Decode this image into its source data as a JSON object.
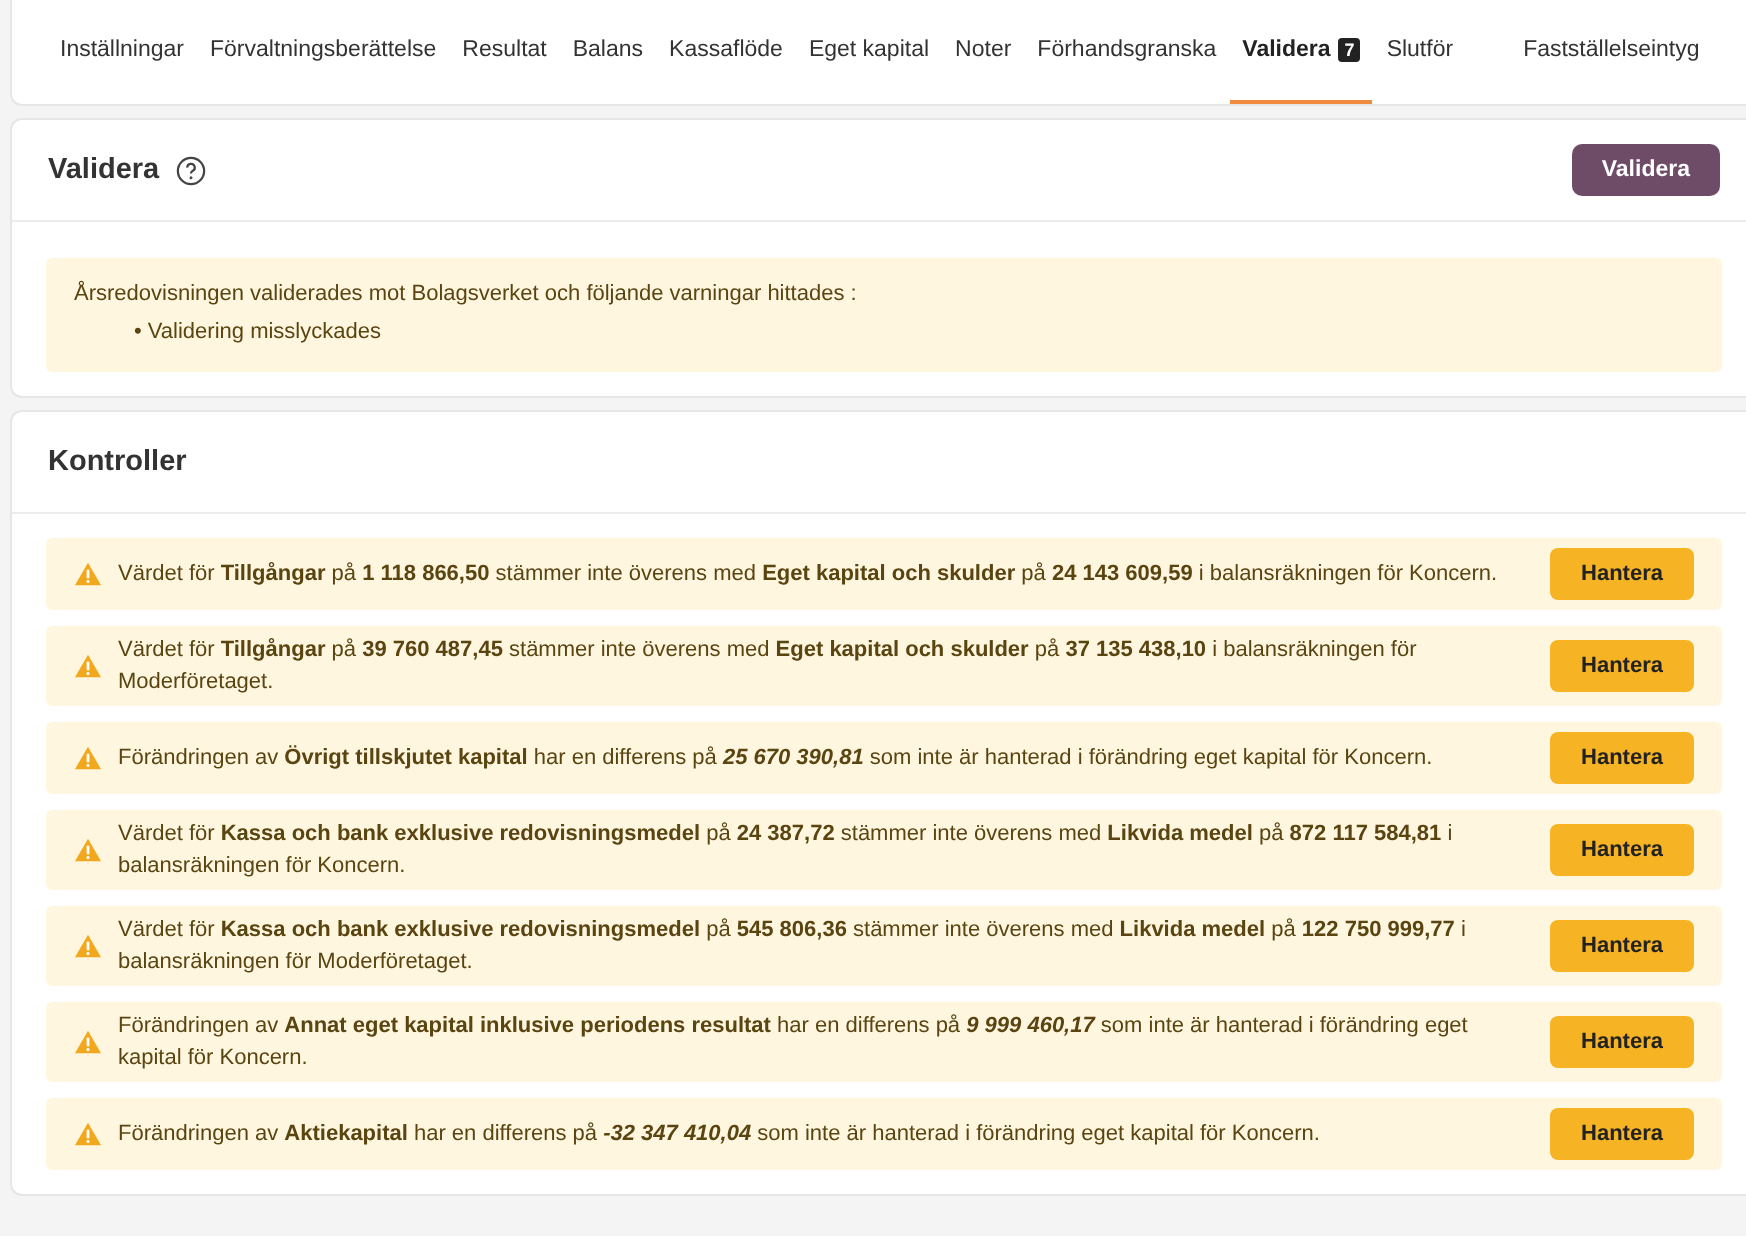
{
  "tabs": [
    {
      "label": "Inställningar",
      "selected": false
    },
    {
      "label": "Förvaltningsberättelse",
      "selected": false
    },
    {
      "label": "Resultat",
      "selected": false
    },
    {
      "label": "Balans",
      "selected": false
    },
    {
      "label": "Kassaflöde",
      "selected": false
    },
    {
      "label": "Eget kapital",
      "selected": false
    },
    {
      "label": "Noter",
      "selected": false
    },
    {
      "label": "Förhandsgranska",
      "selected": false
    },
    {
      "label": "Validera",
      "selected": true,
      "badge": "7"
    },
    {
      "label": "Slutför",
      "selected": false
    },
    {
      "label": "Fastställelseintyg",
      "selected": false
    }
  ],
  "validate_panel": {
    "title": "Validera",
    "button": "Validera",
    "notice": {
      "message": "Årsredovisningen validerades mot Bolagsverket och följande varningar hittades :",
      "items": [
        "• Validering misslyckades"
      ]
    }
  },
  "controls_panel": {
    "title": "Kontroller",
    "warnings": [
      {
        "message": "Värdet för **Tillgångar** på **1 118 866,50** stämmer inte överens med **Eget kapital och skulder** på **24 143 609,59** i balansräkningen för Koncern.",
        "button": "Hantera"
      },
      {
        "message": "Värdet för **Tillgångar** på **39 760 487,45** stämmer inte överens med **Eget kapital och skulder** på **37 135 438,10** i balansräkningen för Moderföretaget.",
        "button": "Hantera"
      },
      {
        "message": "Förändringen av **Övrigt tillskjutet kapital** har en differens på *25 670 390,81* som inte är hanterad i förändring eget kapital för Koncern.",
        "button": "Hantera"
      },
      {
        "message": "Värdet för **Kassa och bank exklusive redovisningsmedel** på **24 387,72** stämmer inte överens med **Likvida medel** på **872 117 584,81** i balansräkningen för Koncern.",
        "button": "Hantera"
      },
      {
        "message": "Värdet för **Kassa och bank exklusive redovisningsmedel** på **545 806,36** stämmer inte överens med **Likvida medel** på **122 750 999,77** i balansräkningen för Moderföretaget.",
        "button": "Hantera"
      },
      {
        "message": "Förändringen av **Annat eget kapital inklusive periodens resultat** har en differens på *9 999 460,17* som inte är hanterad i förändring eget kapital för Koncern.",
        "button": "Hantera"
      },
      {
        "message": "Förändringen av **Aktiekapital** har en differens på *-32 347 410,04* som inte är hanterad i förändring eget kapital för Koncern.",
        "button": "Hantera"
      }
    ]
  }
}
